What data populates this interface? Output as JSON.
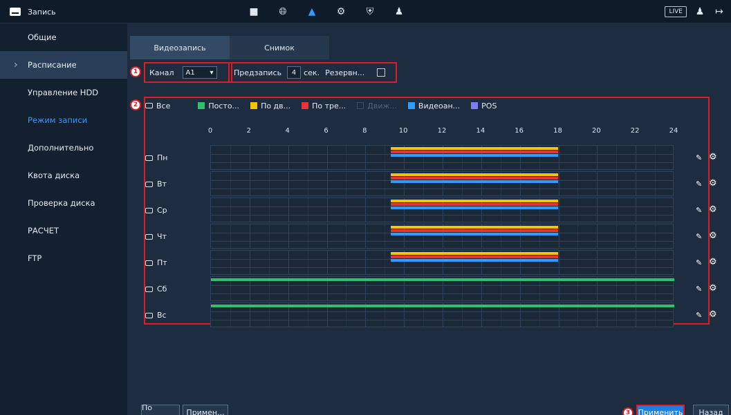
{
  "header": {
    "title": "Запись",
    "live_label": "LIVE",
    "icons": [
      "camera-icon",
      "globe-icon",
      "storage-icon",
      "settings-icon",
      "shield-icon",
      "user-settings-icon"
    ]
  },
  "sidebar": {
    "items": [
      {
        "label": "Общие",
        "state": ""
      },
      {
        "label": "Расписание",
        "state": "selected"
      },
      {
        "label": "Управление HDD",
        "state": ""
      },
      {
        "label": "Режим записи",
        "state": "current"
      },
      {
        "label": "Дополнительно",
        "state": ""
      },
      {
        "label": "Квота диска",
        "state": ""
      },
      {
        "label": "Проверка диска",
        "state": ""
      },
      {
        "label": "РАСЧЕТ",
        "state": ""
      },
      {
        "label": "FTP",
        "state": ""
      }
    ]
  },
  "tabs": [
    {
      "label": "Видеозапись",
      "active": true
    },
    {
      "label": "Снимок",
      "active": false
    }
  ],
  "controls": {
    "channel_label": "Канал",
    "channel_value": "A1",
    "prerecord_label": "Предзапись",
    "prerecord_value": "4",
    "prerecord_unit": "сек.",
    "backup_label": "Резервн..."
  },
  "badges": {
    "one": "1",
    "two": "2",
    "three": "3"
  },
  "legend": {
    "all_label": "Все",
    "items": [
      {
        "label": "Посто...",
        "color": "#2ec36b",
        "checked": true
      },
      {
        "label": "По дв...",
        "color": "#f5c400"
      },
      {
        "label": "По тре...",
        "color": "#e8323c"
      },
      {
        "label": "Движ...",
        "color": "#1d2c3e",
        "disabled": true
      },
      {
        "label": "Видеоан...",
        "color": "#2f9bff"
      },
      {
        "label": "POS",
        "color": "#7d7dfa"
      }
    ]
  },
  "hours": [
    "0",
    "2",
    "4",
    "6",
    "8",
    "10",
    "12",
    "14",
    "16",
    "18",
    "20",
    "22",
    "24"
  ],
  "days": [
    {
      "label": "Пн",
      "segments": [
        {
          "type": "alarm-yellow",
          "start": 9.33,
          "end": 18
        },
        {
          "type": "alarm-red",
          "start": 9.33,
          "end": 18
        },
        {
          "type": "analytics-blue",
          "start": 9.33,
          "end": 18
        }
      ]
    },
    {
      "label": "Вт",
      "segments": [
        {
          "type": "alarm-yellow",
          "start": 9.33,
          "end": 18
        },
        {
          "type": "alarm-red",
          "start": 9.33,
          "end": 18
        },
        {
          "type": "analytics-blue",
          "start": 9.33,
          "end": 18
        }
      ]
    },
    {
      "label": "Ср",
      "segments": [
        {
          "type": "alarm-yellow",
          "start": 9.33,
          "end": 18
        },
        {
          "type": "alarm-red",
          "start": 9.33,
          "end": 18
        },
        {
          "type": "analytics-blue",
          "start": 9.33,
          "end": 18
        }
      ]
    },
    {
      "label": "Чт",
      "segments": [
        {
          "type": "alarm-yellow",
          "start": 9.33,
          "end": 18
        },
        {
          "type": "alarm-red",
          "start": 9.33,
          "end": 18
        },
        {
          "type": "analytics-blue",
          "start": 9.33,
          "end": 18
        }
      ]
    },
    {
      "label": "Пт",
      "segments": [
        {
          "type": "alarm-yellow",
          "start": 9.33,
          "end": 18
        },
        {
          "type": "alarm-red",
          "start": 9.33,
          "end": 18
        },
        {
          "type": "analytics-blue",
          "start": 9.33,
          "end": 18
        }
      ]
    },
    {
      "label": "Сб",
      "segments": [
        {
          "type": "general-green",
          "start": 0,
          "end": 24
        }
      ]
    },
    {
      "label": "Вс",
      "segments": [
        {
          "type": "general-green",
          "start": 0,
          "end": 24
        }
      ]
    }
  ],
  "buttons": {
    "default_label": "По умолч...",
    "copy_label": "Примен...",
    "apply_label": "Применить",
    "back_label": "Назад"
  }
}
